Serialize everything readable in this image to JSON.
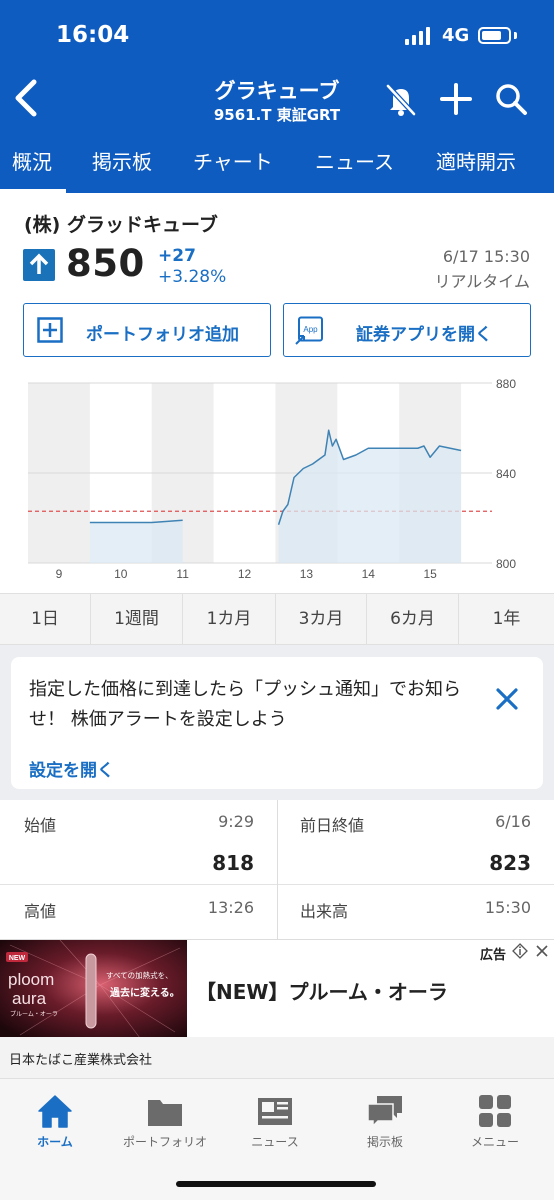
{
  "status": {
    "time": "16:04",
    "network": "4G",
    "battery_level": 0.75
  },
  "header": {
    "title": "グラキューブ",
    "subtitle": "9561.T 東証GRT",
    "back_icon": "chevron-left-icon",
    "actions": [
      "bell-slash-icon",
      "plus-icon",
      "search-icon"
    ]
  },
  "tabs": [
    {
      "label": "概況",
      "active": true
    },
    {
      "label": "掲示板",
      "active": false
    },
    {
      "label": "チャート",
      "active": false
    },
    {
      "label": "ニュース",
      "active": false
    },
    {
      "label": "適時開示",
      "active": false
    }
  ],
  "stock": {
    "company": "(株) グラッドキューブ",
    "price": "850",
    "change": "+27",
    "change_pct": "+3.28%",
    "time": "6/17 15:30",
    "realtime": "リアルタイム",
    "direction": "up"
  },
  "actions": {
    "portfolio": "ポートフォリオ追加",
    "app": "証券アプリを開く",
    "app_icon_text": "App"
  },
  "chart_data": {
    "type": "line",
    "x_ticks": [
      "9",
      "10",
      "11",
      "12",
      "13",
      "14",
      "15"
    ],
    "y_ticks": [
      800,
      840,
      880
    ],
    "ylim": [
      800,
      880
    ],
    "reference_line": 823,
    "grid": true,
    "series": [
      {
        "values": [
          [
            9.5,
            818
          ],
          [
            10.5,
            818
          ],
          [
            11.0,
            819
          ]
        ]
      },
      {
        "values": [
          [
            12.55,
            817
          ],
          [
            12.62,
            823
          ],
          [
            12.7,
            826
          ],
          [
            12.8,
            838
          ],
          [
            12.95,
            842
          ],
          [
            13.1,
            844
          ],
          [
            13.2,
            846
          ],
          [
            13.3,
            848
          ],
          [
            13.36,
            859
          ],
          [
            13.42,
            852
          ],
          [
            13.48,
            855
          ],
          [
            13.6,
            846
          ],
          [
            13.8,
            848
          ],
          [
            14.0,
            851
          ],
          [
            14.3,
            851
          ],
          [
            14.8,
            851
          ],
          [
            14.9,
            852
          ],
          [
            15.0,
            847
          ],
          [
            15.15,
            852
          ],
          [
            15.5,
            850
          ]
        ]
      }
    ],
    "shaded_hours": [
      9,
      11
    ]
  },
  "periods": [
    {
      "label": "1日",
      "active": true
    },
    {
      "label": "1週間",
      "active": false
    },
    {
      "label": "1カ月",
      "active": false
    },
    {
      "label": "3カ月",
      "active": false
    },
    {
      "label": "6カ月",
      "active": false
    },
    {
      "label": "1年",
      "active": false
    }
  ],
  "alert": {
    "text": "指定した価格に到達したら「プッシュ通知」でお知らせ！ 株価アラートを設定しよう",
    "link": "設定を開く"
  },
  "stats": {
    "open_label": "始値",
    "open_time": "9:29",
    "open_value": "818",
    "prev_label": "前日終値",
    "prev_time": "6/16",
    "prev_value": "823",
    "high_label": "高値",
    "high_time": "13:26",
    "volume_label": "出来高",
    "volume_time": "15:30"
  },
  "ad": {
    "label": "広告",
    "title": "【NEW】プルーム・オーラ",
    "advertiser": "日本たばこ産業株式会社",
    "image_badge": "NEW",
    "image_brand_top": "ploom",
    "image_brand_bottom": "aura",
    "image_brand_sub": "プルーム・オーラ",
    "image_copy1": "すべての加熱式を、",
    "image_copy2": "過去に変える。"
  },
  "bottom_nav": [
    {
      "label": "ホーム",
      "icon": "home-icon",
      "active": true
    },
    {
      "label": "ポートフォリオ",
      "icon": "folder-icon",
      "active": false
    },
    {
      "label": "ニュース",
      "icon": "news-icon",
      "active": false
    },
    {
      "label": "掲示板",
      "icon": "chat-icon",
      "active": false
    },
    {
      "label": "メニュー",
      "icon": "grid-icon",
      "active": false
    }
  ],
  "colors": {
    "brand": "#0f5cc0",
    "accent": "#1a6fc4",
    "line": "#3f83b5",
    "reference": "#e05050"
  }
}
